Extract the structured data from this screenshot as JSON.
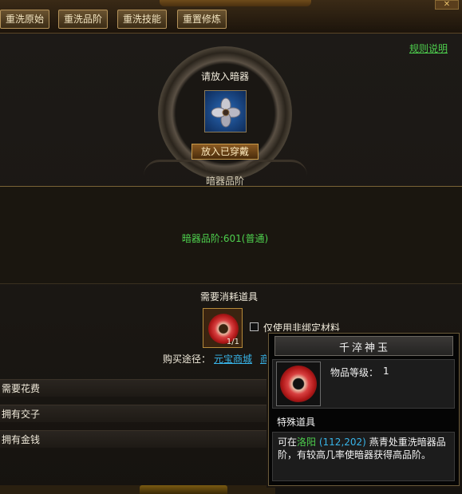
{
  "tabs": [
    {
      "label": "重洗原始"
    },
    {
      "label": "重洗品阶"
    },
    {
      "label": "重洗技能"
    },
    {
      "label": "重置修炼"
    }
  ],
  "close_label": "✕",
  "rules_link": "规则说明",
  "prompt": "请放入暗器",
  "equip_button": "放入已穿戴",
  "grade": {
    "header": "暗器品阶",
    "value": "暗器品阶:601(普通)"
  },
  "consume": {
    "title": "需要消耗道具",
    "count": "1/1",
    "checkbox_label": "仅使用非绑定材料",
    "checkbox_checked": false,
    "buy_label": "购买途径：",
    "buy_links": [
      "元宝商城",
      "商"
    ]
  },
  "rows": [
    {
      "label": "需要花费"
    },
    {
      "label": "拥有交子"
    },
    {
      "label": "拥有金钱"
    }
  ],
  "tooltip": {
    "title": "千淬神玉",
    "level_label": "物品等级：",
    "level_value": "1",
    "type": "特殊道具",
    "desc_prefix": "可在",
    "desc_location": "洛阳",
    "desc_coord": "(112,202)",
    "desc_suffix": "燕青处重洗暗器品阶，有较高几率使暗器获得高品阶。"
  },
  "colors": {
    "accent_green": "#4ed04e",
    "link_blue": "#38b4e8",
    "tab_border": "#b5935a"
  }
}
